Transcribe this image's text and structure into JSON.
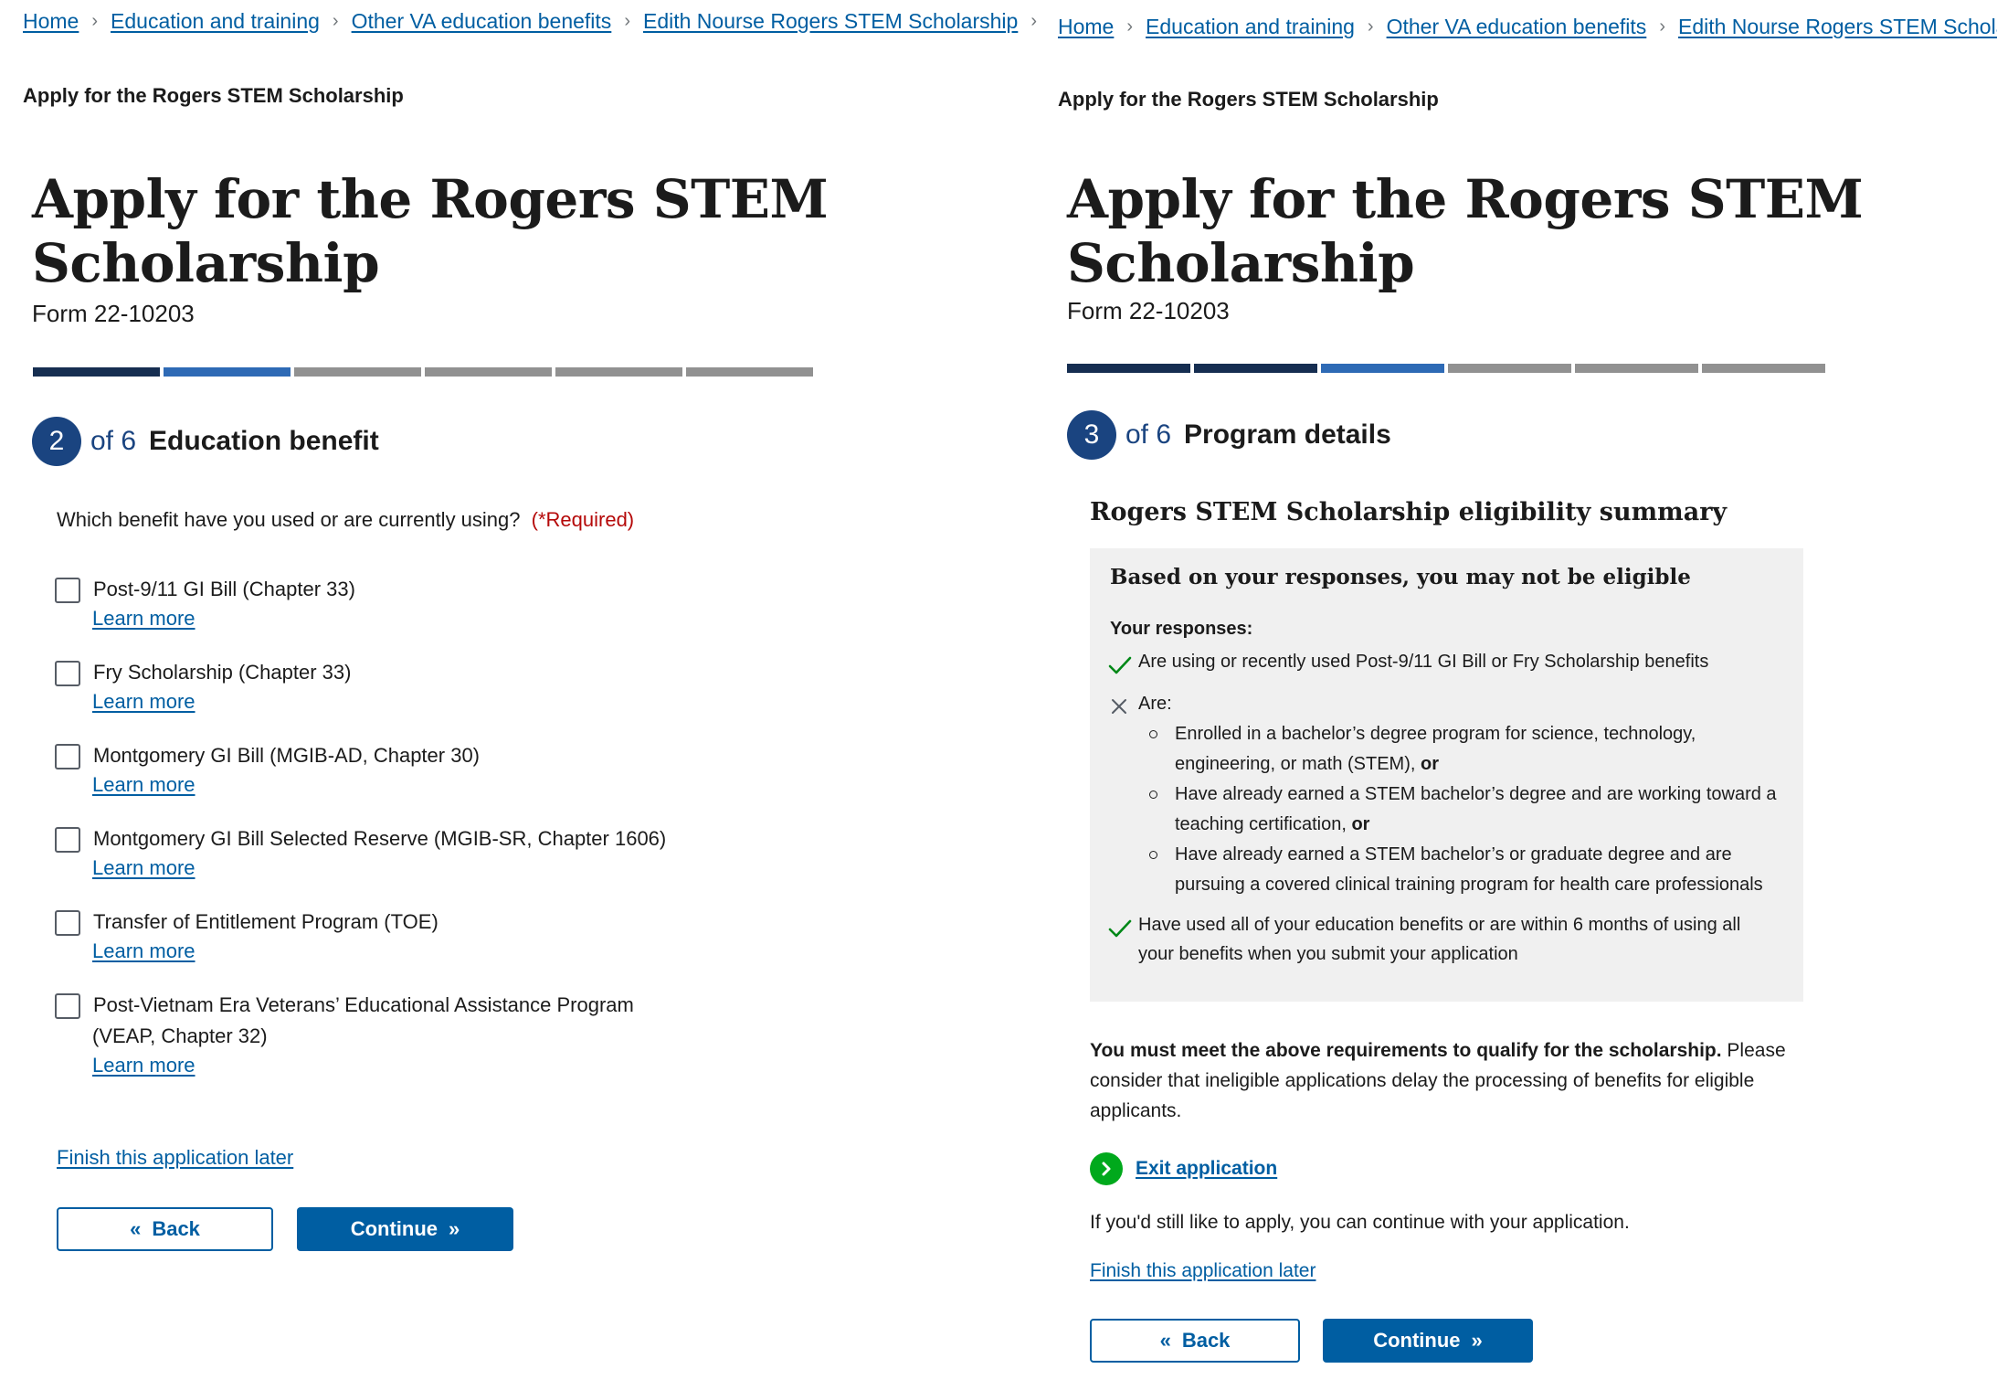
{
  "breadcrumbs": [
    "Home",
    "Education and training",
    "Other VA education benefits",
    "Edith Nourse Rogers STEM Scholarship"
  ],
  "colors": {
    "progress_complete": "#162e51",
    "progress_current": "#2e6ab5",
    "progress_pending": "#919191",
    "primary": "#005ea2",
    "step_circle": "#1a4480",
    "required": "#b50909",
    "success_check": "#00a91c",
    "alert_bg": "#f0f0f0"
  },
  "left": {
    "page_tag": "Apply for the Rogers STEM Scholarship",
    "title_line1": "Apply for the Rogers STEM",
    "title_line2": "Scholarship",
    "form_number": "Form 22-10203",
    "progress": [
      "complete",
      "current",
      "pending",
      "pending",
      "pending",
      "pending"
    ],
    "step_number": "2",
    "step_of": "of 6",
    "step_title": "Education benefit",
    "question": "Which benefit have you used or are currently using?",
    "required": "(*Required)",
    "options": [
      {
        "line1": "Post-9/11 GI Bill (Chapter 33)",
        "line2": "",
        "link": "Learn more"
      },
      {
        "line1": "Fry Scholarship (Chapter 33)",
        "line2": "",
        "link": "Learn more"
      },
      {
        "line1": "Montgomery GI Bill (MGIB-AD, Chapter 30)",
        "line2": "",
        "link": "Learn more"
      },
      {
        "line1": "Montgomery GI Bill Selected Reserve (MGIB-SR, Chapter 1606)",
        "line2": "",
        "link": "Learn more"
      },
      {
        "line1": "Transfer of Entitlement Program (TOE)",
        "line2": "",
        "link": "Learn more"
      },
      {
        "line1": "Post-Vietnam Era Veterans’ Educational Assistance Program",
        "line2": "(VEAP, Chapter 32)",
        "link": "Learn more"
      }
    ],
    "finish_later": "Finish this application later",
    "back": "Back",
    "continue": "Continue"
  },
  "right": {
    "page_tag": "Apply for the Rogers STEM Scholarship",
    "title_line1": "Apply for the Rogers STEM",
    "title_line2": "Scholarship",
    "form_number": "Form 22-10203",
    "progress": [
      "complete",
      "complete",
      "current",
      "pending",
      "pending",
      "pending"
    ],
    "step_number": "3",
    "step_of": "of 6",
    "step_title": "Program details",
    "summary_title": "Rogers STEM Scholarship eligibility summary",
    "alert_heading": "Based on your responses, you may not be eligible",
    "responses_label": "Your responses:",
    "response1": "Are using or recently used Post-9/11 GI Bill or Fry Scholarship benefits",
    "response2_label": "Are:",
    "bullets": [
      {
        "line1": "Enrolled in a bachelor’s degree program for science, technology,",
        "line2": "engineering, or math (STEM), ",
        "bold": "or"
      },
      {
        "line1": "Have already earned a STEM bachelor’s degree and are working toward a",
        "line2": "teaching certification, ",
        "bold": "or"
      },
      {
        "line1": "Have already earned a STEM bachelor’s or graduate degree and are",
        "line2": "pursuing a covered clinical training program for health care professionals",
        "bold": ""
      }
    ],
    "response3_line1": "Have used all of your education benefits or are within 6 months of using all",
    "response3_line2": "your benefits when you submit your application",
    "must_meet_bold": "You must meet the above requirements to qualify for the scholarship.",
    "must_meet_line1_rest": " Please",
    "must_meet_line2": "consider that ineligible applications delay the processing of benefits for eligible",
    "must_meet_line3": "applicants.",
    "exit_application": "Exit application",
    "still_apply": "If you'd still like to apply, you can continue with your application.",
    "finish_later": "Finish this application later",
    "back": "Back",
    "continue": "Continue"
  }
}
